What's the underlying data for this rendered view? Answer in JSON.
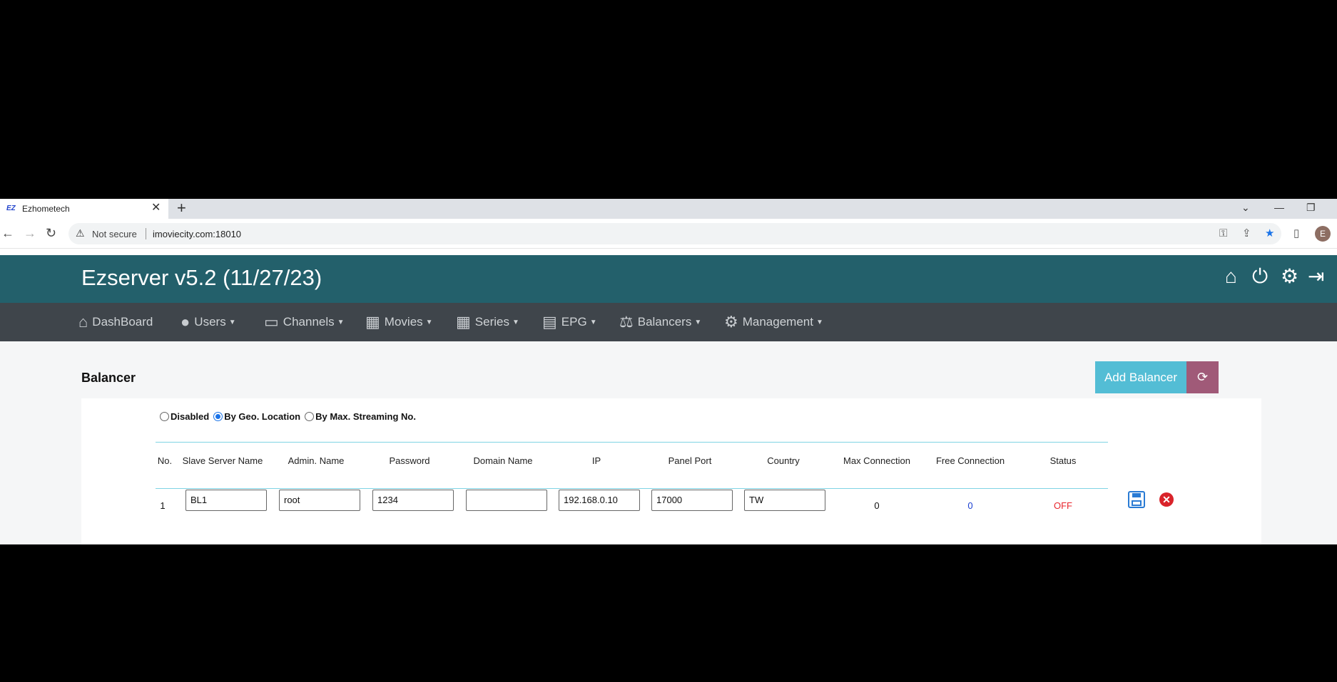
{
  "browser": {
    "tab_title": "Ezhometech",
    "tab_favicon": "EZ",
    "security_label": "Not secure",
    "url": "imoviecity.com:18010",
    "avatar_letter": "E"
  },
  "app": {
    "title": "Ezserver v5.2 (11/27/23)",
    "header_icons": [
      "home-icon",
      "power-icon",
      "gear-icon",
      "logout-icon"
    ]
  },
  "nav": {
    "items": [
      {
        "label": "DashBoard",
        "icon": "home-icon",
        "caret": false
      },
      {
        "label": "Users",
        "icon": "user-icon",
        "caret": true
      },
      {
        "label": "Channels",
        "icon": "monitor-icon",
        "caret": true
      },
      {
        "label": "Movies",
        "icon": "film-icon",
        "caret": true
      },
      {
        "label": "Series",
        "icon": "film-icon",
        "caret": true
      },
      {
        "label": "EPG",
        "icon": "tv-guide-icon",
        "caret": true
      },
      {
        "label": "Balancers",
        "icon": "scale-icon",
        "caret": true
      },
      {
        "label": "Management",
        "icon": "gear-icon",
        "caret": true
      }
    ]
  },
  "page": {
    "title": "Balancer",
    "add_button": "Add Balancer",
    "mode_options": [
      {
        "label": "Disabled",
        "selected": false
      },
      {
        "label": "By Geo. Location",
        "selected": true
      },
      {
        "label": "By Max. Streaming No.",
        "selected": false
      }
    ]
  },
  "table": {
    "headers": [
      "No.",
      "Slave Server Name",
      "Admin. Name",
      "Password",
      "Domain Name",
      "IP",
      "Panel Port",
      "Country",
      "Max Connection",
      "Free Connection",
      "Status"
    ],
    "rows": [
      {
        "no": "1",
        "slave_server_name": "BL1",
        "admin_name": "root",
        "password": "1234",
        "domain_name": "",
        "ip": "192.168.0.10",
        "panel_port": "17000",
        "country": "TW",
        "max_connection": "0",
        "free_connection": "0",
        "status": "OFF"
      }
    ]
  },
  "colors": {
    "header_bg": "#23606b",
    "nav_bg": "#3f454b",
    "add_button": "#53bdd5",
    "refresh_button": "#a05a78",
    "status_off": "#e8262d",
    "free_connection": "#1a3fd1"
  }
}
